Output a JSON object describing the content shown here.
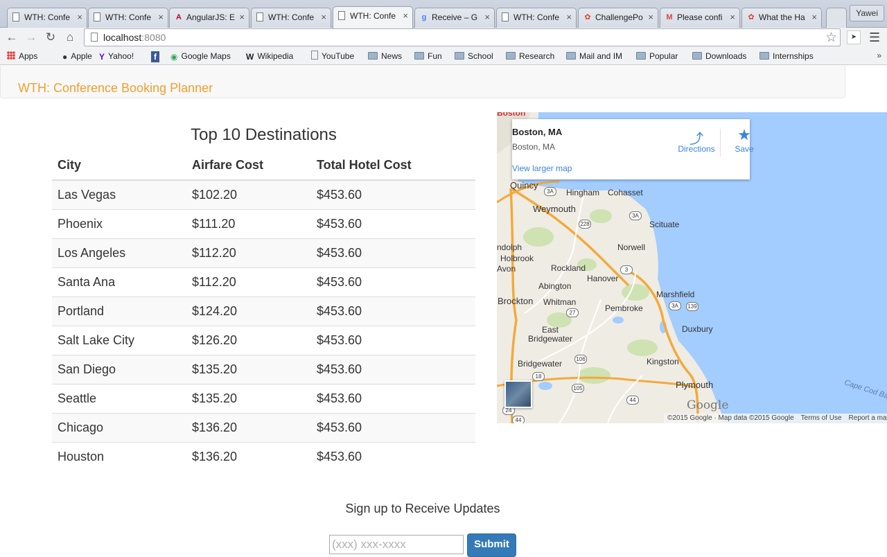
{
  "browser": {
    "tabs": [
      {
        "title": "WTH: Confe",
        "icon": "doc"
      },
      {
        "title": "WTH: Confe",
        "icon": "doc"
      },
      {
        "title": "AngularJS: E",
        "icon": "angular"
      },
      {
        "title": "WTH: Confe",
        "icon": "doc"
      },
      {
        "title": "WTH: Confe",
        "icon": "doc",
        "active": true
      },
      {
        "title": "Receive – G",
        "icon": "google"
      },
      {
        "title": "WTH: Confe",
        "icon": "doc"
      },
      {
        "title": "ChallengePo",
        "icon": "pinwheel"
      },
      {
        "title": "Please confi",
        "icon": "gmail"
      },
      {
        "title": "What the Ha",
        "icon": "pinwheel"
      }
    ],
    "profile_name": "Yawei",
    "url_host": "localhost",
    "url_port": ":8080",
    "bookmarks": [
      {
        "label": "Apps",
        "icon": "apps"
      },
      {
        "label": "Apple",
        "icon": "apple"
      },
      {
        "label": "Yahoo!",
        "icon": "yahoo"
      },
      {
        "label": "",
        "icon": "facebook"
      },
      {
        "label": "Google Maps",
        "icon": "maps"
      },
      {
        "label": "Wikipedia",
        "icon": "wikipedia"
      },
      {
        "label": "YouTube",
        "icon": "page"
      },
      {
        "label": "News",
        "icon": "folder"
      },
      {
        "label": "Fun",
        "icon": "folder"
      },
      {
        "label": "School",
        "icon": "folder"
      },
      {
        "label": "Research",
        "icon": "folder"
      },
      {
        "label": "Mail and IM",
        "icon": "folder"
      },
      {
        "label": "Popular",
        "icon": "folder"
      },
      {
        "label": "Downloads",
        "icon": "folder"
      },
      {
        "label": "Internships",
        "icon": "folder"
      }
    ],
    "bookmarks_overflow": "»"
  },
  "navbar": {
    "brand": "WTH: Conference Booking Planner"
  },
  "destinations": {
    "title": "Top 10 Destinations",
    "headers": [
      "City",
      "Airfare Cost",
      "Total Hotel Cost"
    ],
    "rows": [
      [
        "Las Vegas",
        "$102.20",
        "$453.60"
      ],
      [
        "Phoenix",
        "$111.20",
        "$453.60"
      ],
      [
        "Los Angeles",
        "$112.20",
        "$453.60"
      ],
      [
        "Santa Ana",
        "$112.20",
        "$453.60"
      ],
      [
        "Portland",
        "$124.20",
        "$453.60"
      ],
      [
        "Salt Lake City",
        "$126.20",
        "$453.60"
      ],
      [
        "San Diego",
        "$135.20",
        "$453.60"
      ],
      [
        "Seattle",
        "$135.20",
        "$453.60"
      ],
      [
        "Chicago",
        "$136.20",
        "$453.60"
      ],
      [
        "Houston",
        "$136.20",
        "$453.60"
      ]
    ]
  },
  "map": {
    "place_name": "Boston, MA",
    "place_address": "Boston, MA",
    "view_larger": "View larger map",
    "directions_label": "Directions",
    "save_label": "Save",
    "labels": [
      "Quincy",
      "Hingham",
      "Cohasset",
      "Weymouth",
      "Scituate",
      "Norwell",
      "ndolph",
      "Holbrook",
      "Avon",
      "Rockland",
      "Hanover",
      "Abington",
      "Marshfield",
      "Brockton",
      "Whitman",
      "Pembroke",
      "Duxbury",
      "East Bridgewater",
      "Bridgewater",
      "Kingston",
      "Plymouth",
      "Cape Cod Bay",
      "Boston"
    ],
    "shields": [
      "3A",
      "228",
      "3A",
      "3",
      "27",
      "3A",
      "139",
      "106",
      "18",
      "105",
      "44",
      "24",
      "44"
    ],
    "logo": "Google",
    "footer": [
      "©2015 Google · Map data ©2015 Google",
      "Terms of Use",
      "Report a ma"
    ]
  },
  "signup": {
    "title": "Sign up to Receive Updates",
    "placeholder": "(xxx) xxx-xxxx",
    "submit_label": "Submit"
  }
}
